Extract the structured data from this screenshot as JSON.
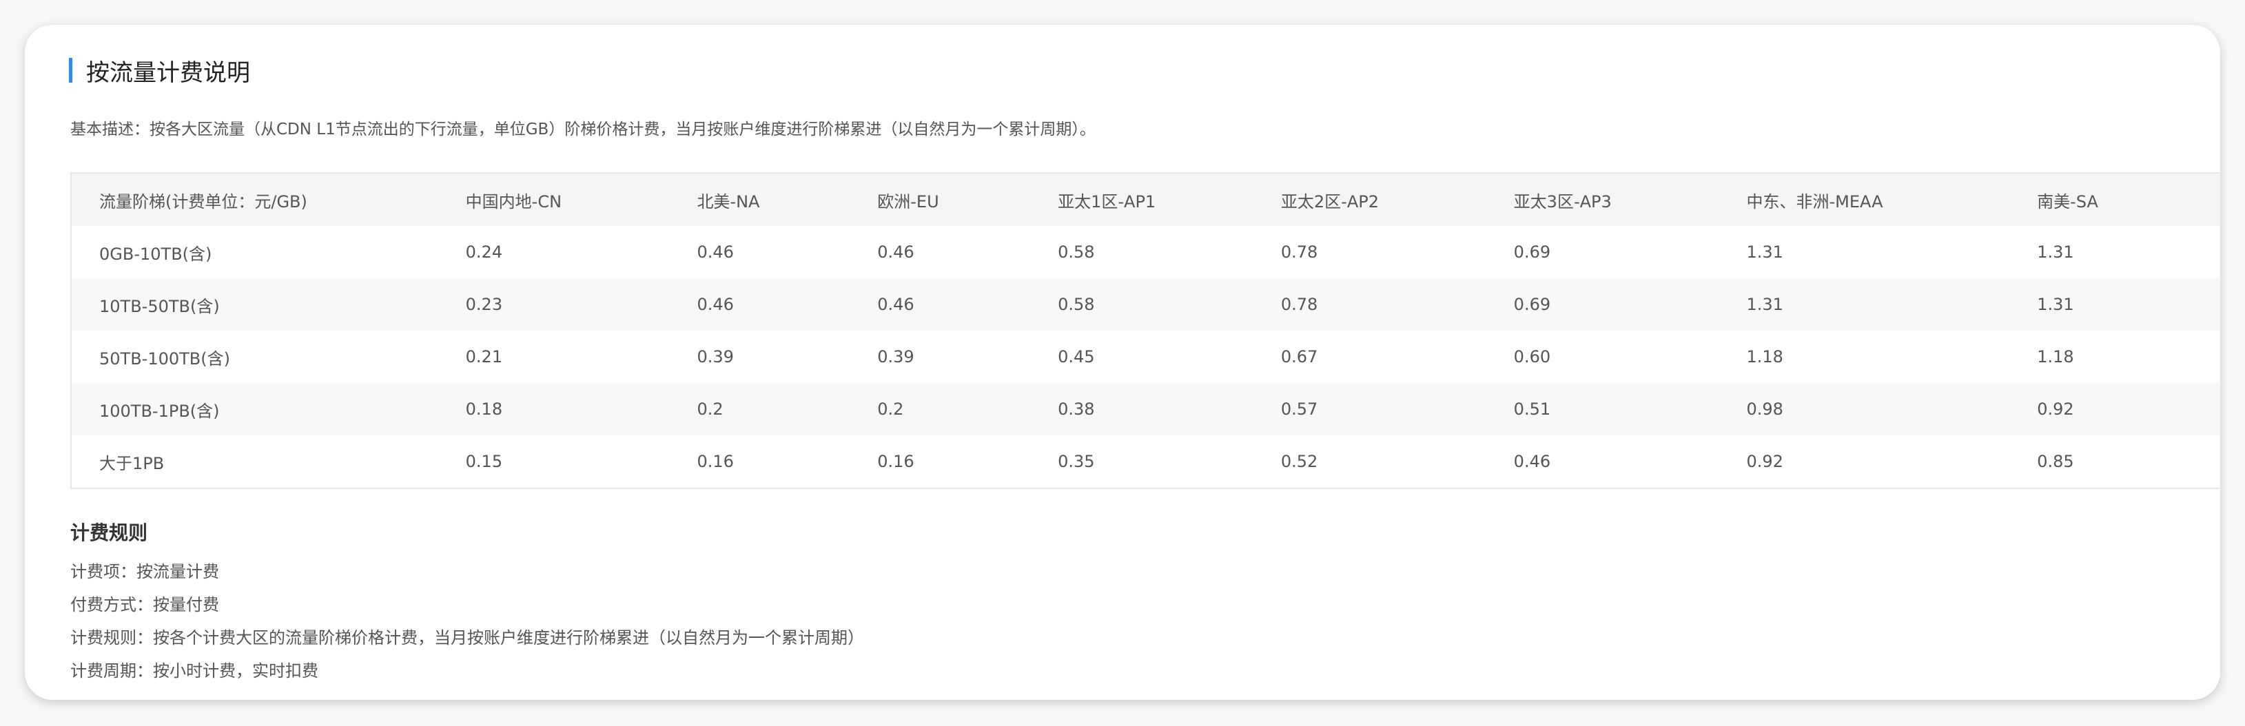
{
  "section": {
    "title": "按流量计费说明",
    "description": "基本描述：按各大区流量（从CDN L1节点流出的下行流量，单位GB）阶梯价格计费，当月按账户维度进行阶梯累进（以自然月为一个累计周期）。"
  },
  "table": {
    "headers": [
      "流量阶梯(计费单位：元/GB)",
      "中国内地-CN",
      "北美-NA",
      "欧洲-EU",
      "亚太1区-AP1",
      "亚太2区-AP2",
      "亚太3区-AP3",
      "中东、非洲-MEAA",
      "南美-SA"
    ],
    "rows": [
      [
        "0GB-10TB(含)",
        "0.24",
        "0.46",
        "0.46",
        "0.58",
        "0.78",
        "0.69",
        "1.31",
        "1.31"
      ],
      [
        "10TB-50TB(含)",
        "0.23",
        "0.46",
        "0.46",
        "0.58",
        "0.78",
        "0.69",
        "1.31",
        "1.31"
      ],
      [
        "50TB-100TB(含)",
        "0.21",
        "0.39",
        "0.39",
        "0.45",
        "0.67",
        "0.60",
        "1.18",
        "1.18"
      ],
      [
        "100TB-1PB(含)",
        "0.18",
        "0.2",
        "0.2",
        "0.38",
        "0.57",
        "0.51",
        "0.98",
        "0.92"
      ],
      [
        "大于1PB",
        "0.15",
        "0.16",
        "0.16",
        "0.35",
        "0.52",
        "0.46",
        "0.92",
        "0.85"
      ]
    ]
  },
  "rules": {
    "heading": "计费规则",
    "items": [
      "计费项：按流量计费",
      "付费方式：按量付费",
      "计费规则：按各个计费大区的流量阶梯价格计费，当月按账户维度进行阶梯累进（以自然月为一个累计周期）",
      "计费周期：按小时计费，实时扣费"
    ]
  },
  "colors": {
    "accent": "#2d8cf0",
    "header_bg": "#f5f5f5",
    "alt_row_bg": "#f8f8f8"
  }
}
